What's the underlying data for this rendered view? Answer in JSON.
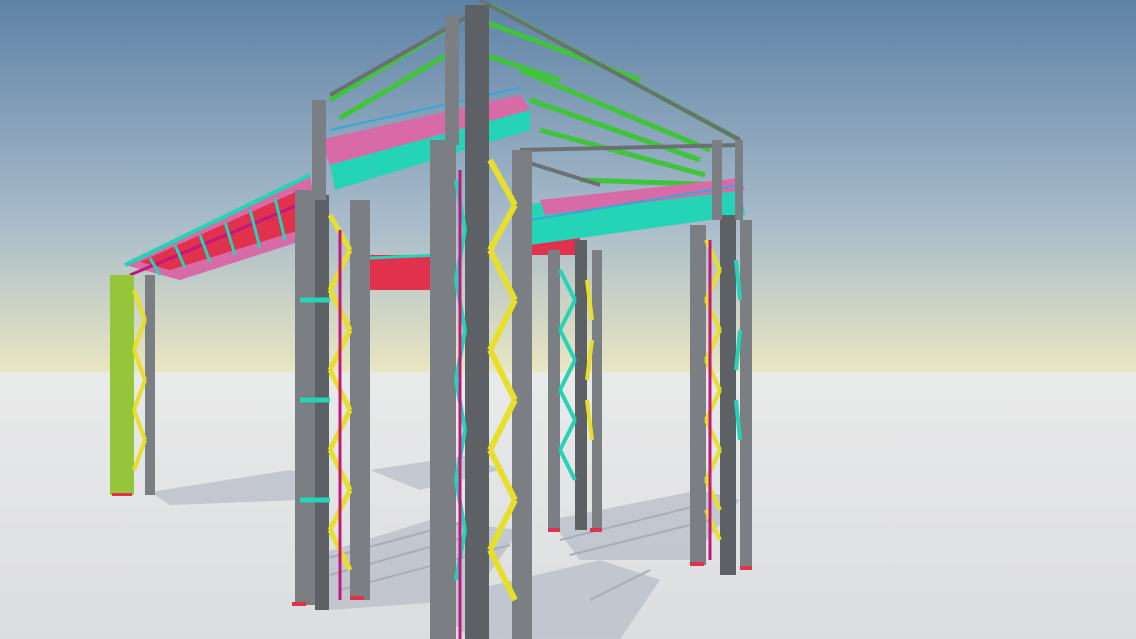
{
  "scene": {
    "subject": "steel-structure-3d-render",
    "colors": {
      "sky_top": "#5e82a6",
      "sky_mid": "#a9bccb",
      "sky_horizon": "#e9e6c2",
      "ground": "#e4e5e6",
      "shadow": "#b7bcc6",
      "column": "#7b7f84",
      "column_dark": "#5d6166",
      "brace_yellow": "#e8df2a",
      "brace_cyan": "#25d3b7",
      "accent_magenta": "#c0187c",
      "roof_green": "#3fc43a",
      "girder_red": "#e0314d",
      "girder_pink": "#d06bb0",
      "column_lime": "#95c63a"
    }
  }
}
